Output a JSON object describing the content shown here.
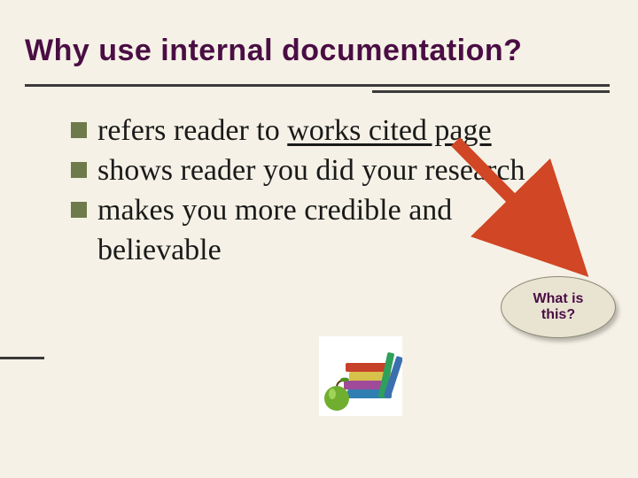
{
  "title": "Why use internal documentation?",
  "bullets": [
    {
      "prefix": "refers reader to ",
      "underlined": "works cited page",
      "suffix": ""
    },
    {
      "prefix": "shows reader you did your research",
      "underlined": "",
      "suffix": ""
    },
    {
      "prefix": "makes you more credible and believable",
      "underlined": "",
      "suffix": ""
    }
  ],
  "callout": {
    "line1": "What is",
    "line2": "this?"
  },
  "icons": {
    "bullet": "square-bullet-icon",
    "arrow": "arrow-down-right-icon",
    "books": "books-apple-icon"
  },
  "colors": {
    "bg": "#f5f1e6",
    "title": "#4a0d44",
    "bullet": "#6f7a4a",
    "arrow": "#d14624"
  }
}
